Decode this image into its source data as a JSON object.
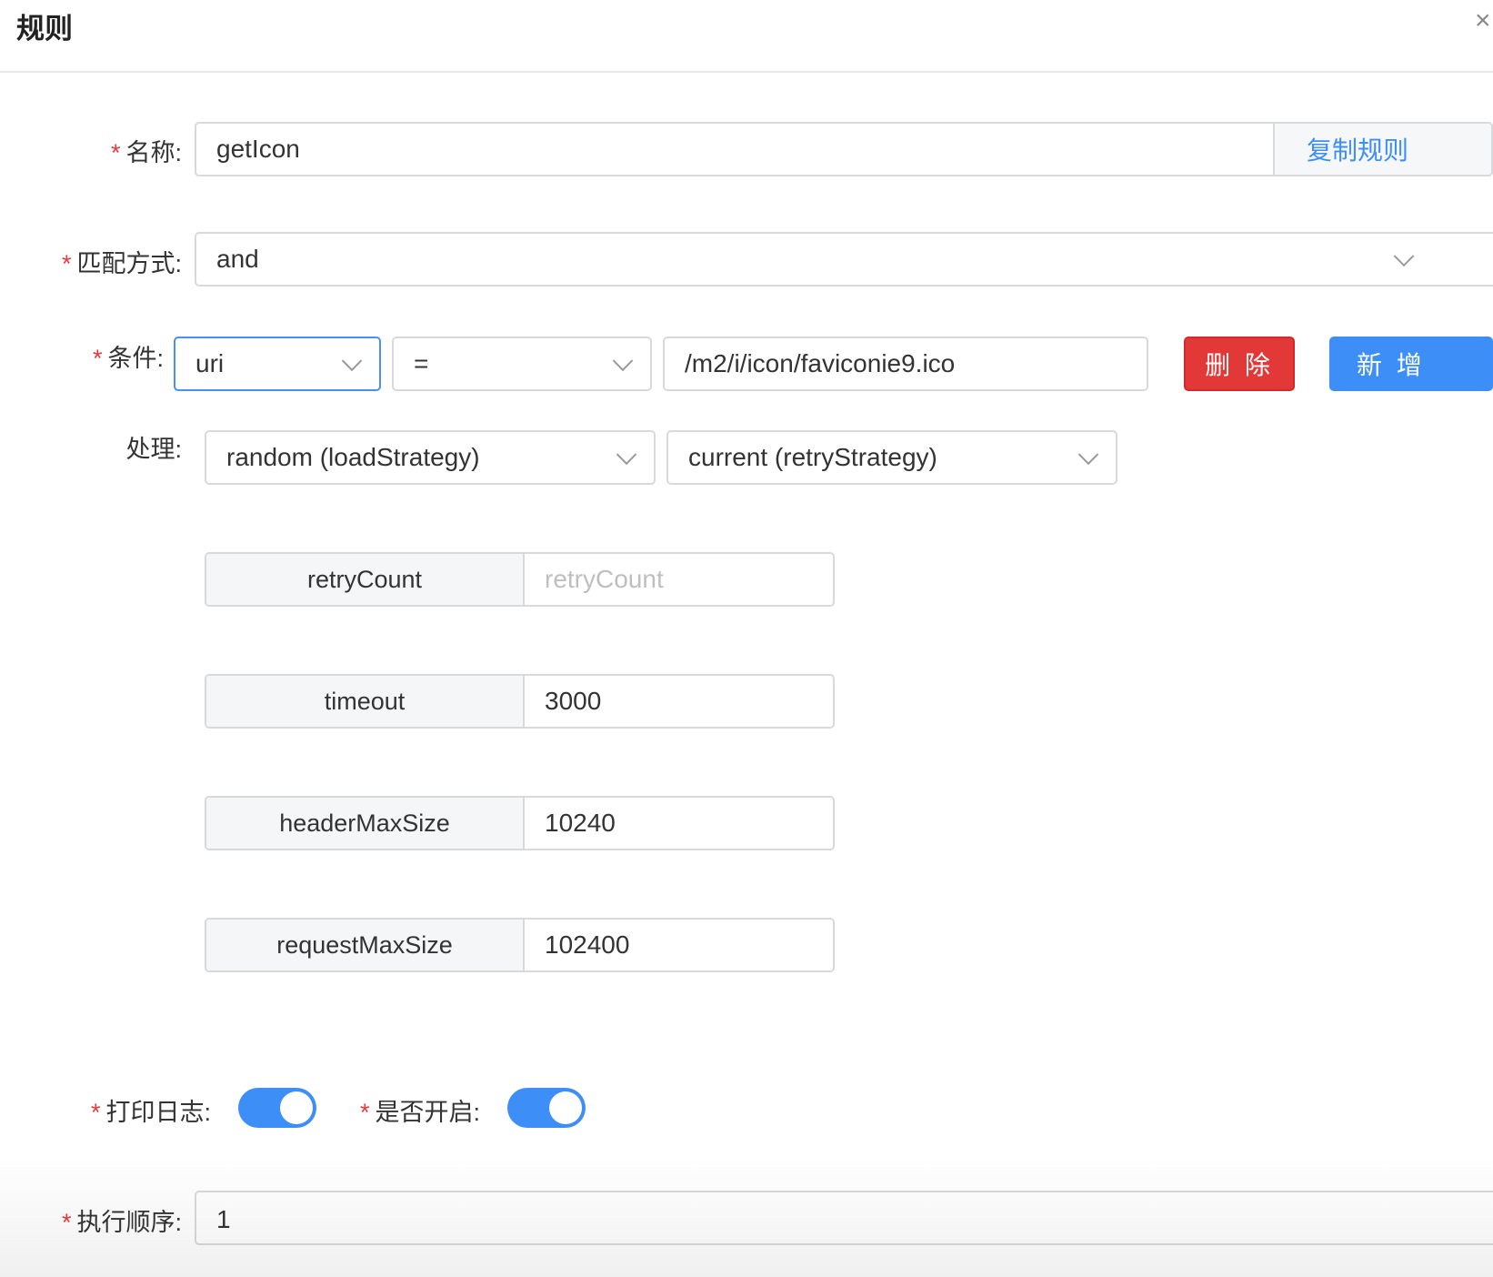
{
  "modal": {
    "title": "规则",
    "close_glyph": "×"
  },
  "form": {
    "name": {
      "required": "*",
      "label": "名称:",
      "value": "getIcon",
      "copy_button": "复制规则"
    },
    "match": {
      "required": "*",
      "label": "匹配方式:",
      "value": "and"
    },
    "condition": {
      "required": "*",
      "label": "条件:",
      "param_type": "uri",
      "operator": "=",
      "value": "/m2/i/icon/faviconie9.ico",
      "delete_button": "删 除",
      "add_button": "新 增"
    },
    "handle": {
      "label": "处理:",
      "load_strategy": "random (loadStrategy)",
      "retry_strategy": "current (retryStrategy)",
      "fields": [
        {
          "key": "retryCount",
          "value": "",
          "placeholder": "retryCount"
        },
        {
          "key": "timeout",
          "value": "3000",
          "placeholder": ""
        },
        {
          "key": "headerMaxSize",
          "value": "10240",
          "placeholder": ""
        },
        {
          "key": "requestMaxSize",
          "value": "102400",
          "placeholder": ""
        }
      ]
    },
    "log": {
      "required": "*",
      "label": "打印日志:",
      "on": true
    },
    "enabled": {
      "required": "*",
      "label": "是否开启:",
      "on": true
    },
    "sort": {
      "required": "*",
      "label": "执行顺序:",
      "value": "1"
    }
  },
  "colors": {
    "primary": "#3d8ff7",
    "danger": "#e23838",
    "required": "#e83a3a"
  }
}
